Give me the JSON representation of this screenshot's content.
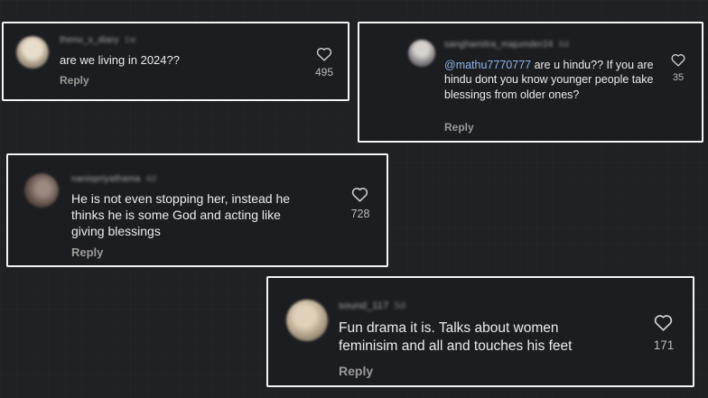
{
  "comments": [
    {
      "username": "thenu_s_diary",
      "time": "1w",
      "text": "are we living in 2024??",
      "reply_label": "Reply",
      "likes": "495",
      "avatar_color": "#c9b9a2"
    },
    {
      "username": "sanghamitra_majumder24",
      "time": "6d",
      "mention": "@mathu7770777",
      "text": " are u hindu?? If you are hindu dont you know younger people take blessings from older ones?",
      "reply_label": "Reply",
      "likes": "35",
      "avatar_color": "#8b8b92"
    },
    {
      "username": "nanispriyathama",
      "time": "4d",
      "text": "He is not even stopping her, instead he thinks he is some God and acting like giving blessings",
      "reply_label": "Reply",
      "likes": "728",
      "avatar_color": "#6b5a52"
    },
    {
      "username": "sound_117",
      "time": "5d",
      "text": "Fun drama it is. Talks about women feminisim and all and touches his feet",
      "reply_label": "Reply",
      "likes": "171",
      "avatar_color": "#b6a98e"
    }
  ],
  "icons": {
    "like": "heart-outline-icon"
  },
  "colors": {
    "border": "#f4f4f4",
    "mention": "#8fb4ec",
    "background": "#1f2124"
  }
}
